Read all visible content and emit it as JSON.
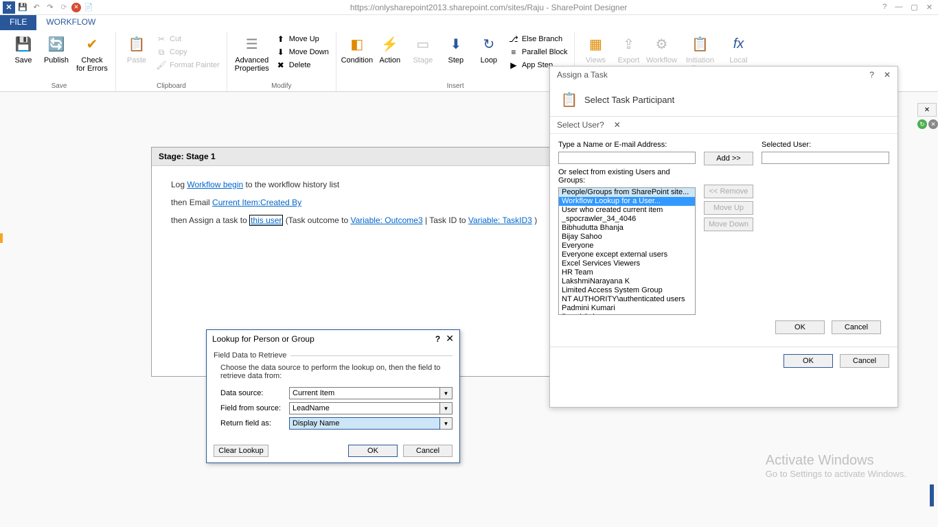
{
  "titlebar": {
    "url_title": "https://onlysharepoint2013.sharepoint.com/sites/Raju - SharePoint Designer"
  },
  "tabs": {
    "file": "FILE",
    "workflow": "WORKFLOW"
  },
  "ribbon": {
    "save": "Save",
    "publish": "Publish",
    "check": "Check\nfor Errors",
    "save_group": "Save",
    "paste": "Paste",
    "cut": "Cut",
    "copy": "Copy",
    "format_painter": "Format Painter",
    "clipboard_group": "Clipboard",
    "advanced_props": "Advanced\nProperties",
    "move_up": "Move Up",
    "move_down": "Move Down",
    "delete": "Delete",
    "modify_group": "Modify",
    "condition": "Condition",
    "action": "Action",
    "stage": "Stage",
    "step": "Step",
    "loop": "Loop",
    "else_branch": "Else Branch",
    "parallel_block": "Parallel Block",
    "app_step": "App Step",
    "insert_group": "Insert",
    "views": "Views",
    "export": "Export",
    "workflow_btn": "Workflow",
    "initiation_form": "Initiation Form",
    "local": "Local"
  },
  "stage": {
    "title": "Stage: Stage 1",
    "line1_a": "Log ",
    "line1_link": "Workflow begin",
    "line1_b": " to the workflow history list",
    "line2_a": "then Email ",
    "line2_link": "Current Item:Created By",
    "line3_a": "then Assign a task to ",
    "line3_user": "this user",
    "line3_b": " (Task outcome to ",
    "line3_link2": "Variable: Outcome3",
    "line3_c": " | Task ID to ",
    "line3_link3": "Variable: TaskID3",
    "line3_d": " )"
  },
  "lookup": {
    "title": "Lookup for Person or Group",
    "fieldset": "Field Data to Retrieve",
    "hint": "Choose the data source to perform the lookup on, then the field to retrieve data from:",
    "data_source_lbl": "Data source:",
    "data_source_val": "Current Item",
    "field_lbl": "Field from source:",
    "field_val": "LeadName",
    "return_lbl": "Return field as:",
    "return_val": "Display Name",
    "clear": "Clear Lookup",
    "ok": "OK",
    "cancel": "Cancel"
  },
  "task": {
    "title": "Assign a Task",
    "subtitle": "Select Task Participant",
    "section": "Select User",
    "type_label": "Type a Name or E-mail Address:",
    "selected_label": "Selected User:",
    "add": "Add >>",
    "remove": "<< Remove",
    "moveup": "Move Up",
    "movedown": "Move Down",
    "or_label": "Or select from existing Users and Groups:",
    "list": [
      "People/Groups from SharePoint site...",
      "Workflow Lookup for a User...",
      "User who created current item",
      "_spocrawler_34_4046",
      "Bibhudutta Bhanja",
      "Bijay Sahoo",
      "Everyone",
      "Everyone except external users",
      "Excel Services Viewers",
      "HR Team",
      "LakshmiNarayana K",
      "Limited Access System Group",
      "NT AUTHORITY\\authenticated users",
      "Padmini Kumari",
      "Preeti Sahu"
    ],
    "ok": "OK",
    "cancel": "Cancel"
  },
  "watermark": {
    "l1": "Activate Windows",
    "l2": "Go to Settings to activate Windows."
  }
}
